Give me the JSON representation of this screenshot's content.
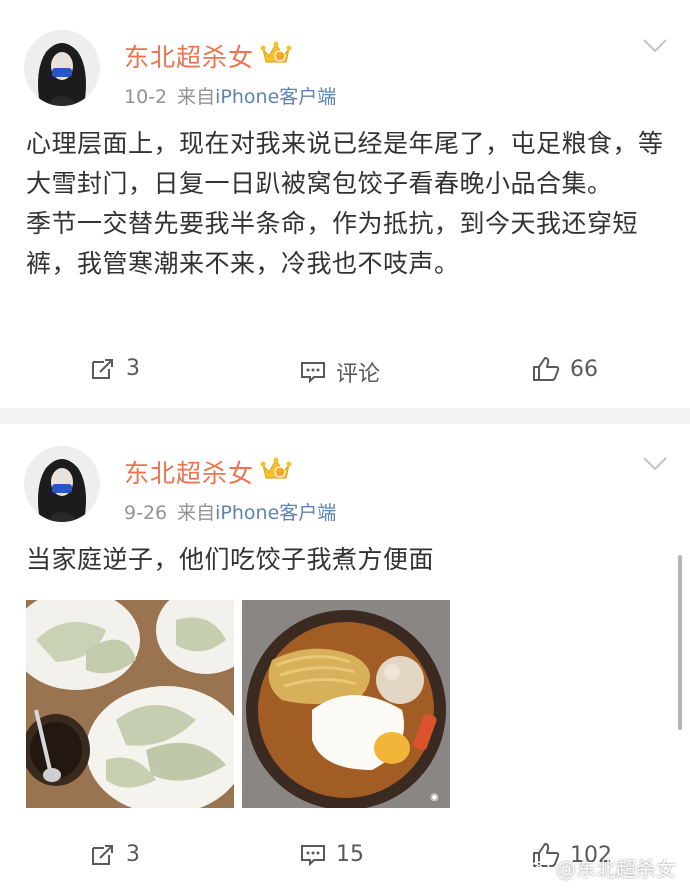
{
  "posts": [
    {
      "author": "东北超杀女",
      "date": "10-2",
      "source_prefix": "来自",
      "source_device": "iPhone客户端",
      "content": [
        "心理层面上，现在对我来说已经是年尾了，屯足粮食，等大雪封门，日复一日趴被窝包饺子看春晚小品合集。",
        "季节一交替先要我半条命，作为抵抗，到今天我还穿短裤，我管寒潮来不来，冷我也不吱声。"
      ],
      "repost_count": "3",
      "comment_label": "评论",
      "like_count": "66"
    },
    {
      "author": "东北超杀女",
      "date": "9-26",
      "source_prefix": "来自",
      "source_device": "iPhone客户端",
      "content": [
        "当家庭逆子，他们吃饺子我煮方便面"
      ],
      "repost_count": "3",
      "comment_count": "15",
      "like_count": "102"
    }
  ],
  "watermark": "@东北超杀女",
  "colors": {
    "author_name": "#eb7350",
    "source_link": "#5d83b3",
    "meta_gray": "#939393",
    "body_text": "#333333",
    "page_background": "#f2f2f2"
  },
  "icons": [
    "crown-badge-icon",
    "chevron-down-icon",
    "repost-icon",
    "comment-icon",
    "like-icon",
    "weibo-logo-icon"
  ]
}
